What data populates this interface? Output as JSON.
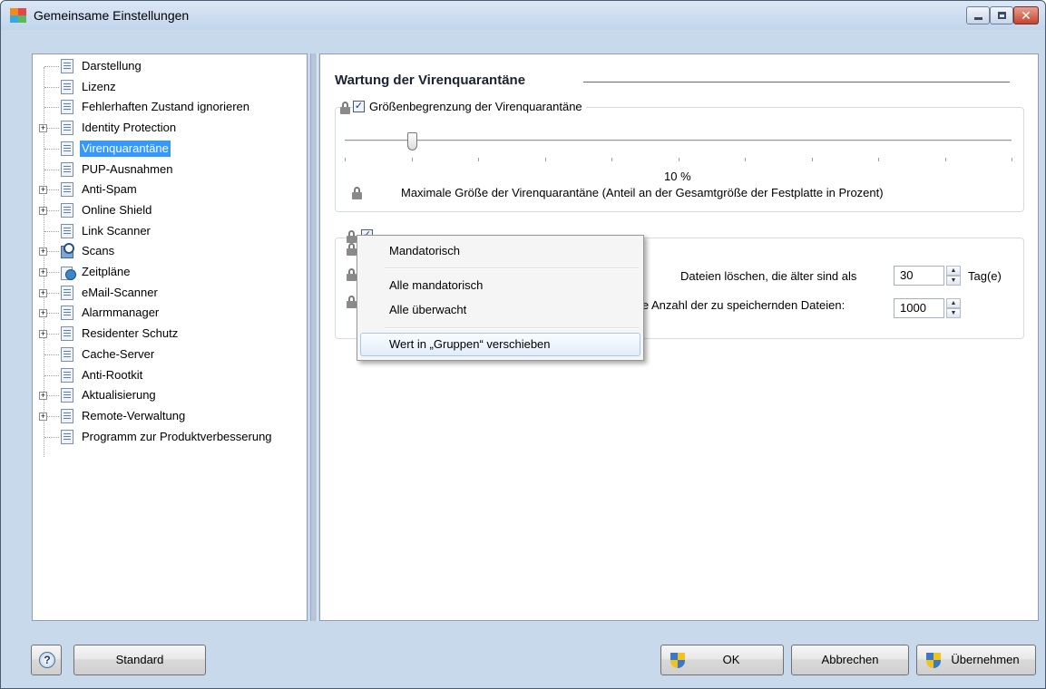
{
  "window": {
    "title": "Gemeinsame Einstellungen",
    "close_glyph": "✕"
  },
  "tree": {
    "items": [
      {
        "label": "Darstellung",
        "icon": "document-icon",
        "expandable": false
      },
      {
        "label": "Lizenz",
        "icon": "document-icon",
        "expandable": false
      },
      {
        "label": "Fehlerhaften Zustand ignorieren",
        "icon": "document-icon",
        "expandable": false
      },
      {
        "label": "Identity Protection",
        "icon": "document-icon",
        "expandable": true
      },
      {
        "label": "Virenquarantäne",
        "icon": "document-icon",
        "expandable": false,
        "selected": true
      },
      {
        "label": "PUP-Ausnahmen",
        "icon": "document-icon",
        "expandable": false
      },
      {
        "label": "Anti-Spam",
        "icon": "document-icon",
        "expandable": true
      },
      {
        "label": "Online Shield",
        "icon": "document-icon",
        "expandable": true
      },
      {
        "label": "Link Scanner",
        "icon": "document-icon",
        "expandable": false
      },
      {
        "label": "Scans",
        "icon": "scan-icon",
        "expandable": true
      },
      {
        "label": "Zeitpläne",
        "icon": "schedule-icon",
        "expandable": true
      },
      {
        "label": "eMail-Scanner",
        "icon": "document-icon",
        "expandable": true
      },
      {
        "label": "Alarmmanager",
        "icon": "document-icon",
        "expandable": true
      },
      {
        "label": "Residenter Schutz",
        "icon": "document-icon",
        "expandable": true
      },
      {
        "label": "Cache-Server",
        "icon": "document-icon",
        "expandable": false
      },
      {
        "label": "Anti-Rootkit",
        "icon": "document-icon",
        "expandable": false
      },
      {
        "label": "Aktualisierung",
        "icon": "document-icon",
        "expandable": true
      },
      {
        "label": "Remote-Verwaltung",
        "icon": "document-icon",
        "expandable": true
      },
      {
        "label": "Programm zur Produktverbesserung",
        "icon": "document-icon",
        "expandable": false
      }
    ],
    "expander_glyph": "+"
  },
  "content": {
    "section_title": "Wartung der Virenquarantäne",
    "size_limit": {
      "checkbox_label": "Größenbegrenzung der Virenquarantäne",
      "checked": true,
      "check_glyph": "✓",
      "slider_percent": 10,
      "value_label": "10 %",
      "description": "Maximale Größe der Virenquarantäne (Anteil an der Gesamtgröße der Festplatte in Prozent)"
    },
    "auto_delete": {
      "checked": true,
      "delete_older_label": "Dateien löschen, die älter sind als",
      "days_value": "30",
      "days_unit": "Tag(e)",
      "max_files_label": "le Anzahl der zu speichernden Dateien:",
      "max_files_value": "1000"
    }
  },
  "context_menu": {
    "items": [
      {
        "label": "Mandatorisch"
      },
      {
        "label": "Alle mandatorisch"
      },
      {
        "label": "Alle überwacht"
      },
      {
        "label": "Wert in „Gruppen“ verschieben",
        "highlighted": true
      }
    ]
  },
  "buttons": {
    "help_glyph": "?",
    "standard": "Standard",
    "ok": "OK",
    "cancel": "Abbrechen",
    "apply": "Übernehmen"
  },
  "colors": {
    "selection": "#3399ff",
    "window_bg": "#c9d9ec"
  }
}
